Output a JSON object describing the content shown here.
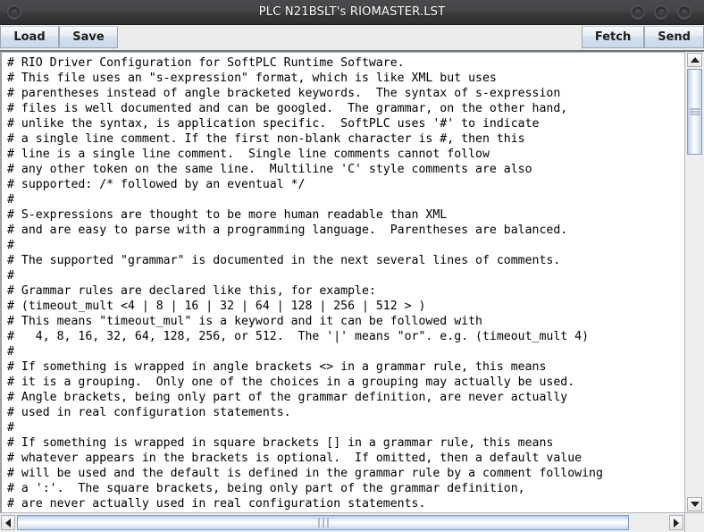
{
  "window": {
    "title": "PLC N21BSLT's RIOMASTER.LST",
    "controls": {
      "menu": "menu-button",
      "minimize": "minimize-button",
      "maximize": "maximize-button",
      "close": "close-button"
    }
  },
  "toolbar": {
    "left_buttons": [
      {
        "label": "Load",
        "name": "load-button"
      },
      {
        "label": "Save",
        "name": "save-button"
      }
    ],
    "right_buttons": [
      {
        "label": "Fetch",
        "name": "fetch-button"
      },
      {
        "label": "Send",
        "name": "send-button"
      }
    ]
  },
  "editor": {
    "lines": [
      "# RIO Driver Configuration for SoftPLC Runtime Software.",
      "# This file uses an \"s-expression\" format, which is like XML but uses",
      "# parentheses instead of angle bracketed keywords.  The syntax of s-expression",
      "# files is well documented and can be googled.  The grammar, on the other hand,",
      "# unlike the syntax, is application specific.  SoftPLC uses '#' to indicate",
      "# a single line comment. If the first non-blank character is #, then this",
      "# line is a single line comment.  Single line comments cannot follow",
      "# any other token on the same line.  Multiline 'C' style comments are also",
      "# supported: /* followed by an eventual */",
      "#",
      "# S-expressions are thought to be more human readable than XML",
      "# and are easy to parse with a programming language.  Parentheses are balanced.",
      "#",
      "# The supported \"grammar\" is documented in the next several lines of comments.",
      "#",
      "# Grammar rules are declared like this, for example:",
      "# (timeout_mult <4 | 8 | 16 | 32 | 64 | 128 | 256 | 512 > )",
      "# This means \"timeout_mul\" is a keyword and it can be followed with",
      "#   4, 8, 16, 32, 64, 128, 256, or 512.  The '|' means \"or\". e.g. (timeout_mult 4)",
      "#",
      "# If something is wrapped in angle brackets <> in a grammar rule, this means",
      "# it is a grouping.  Only one of the choices in a grouping may actually be used.",
      "# Angle brackets, being only part of the grammar definition, are never actually",
      "# used in real configuration statements.",
      "#",
      "# If something is wrapped in square brackets [] in a grammar rule, this means",
      "# whatever appears in the brackets is optional.  If omitted, then a default value",
      "# will be used and the default is defined in the grammar rule by a comment following",
      "# a ':'.  The square brackets, being only part of the grammar definition,",
      "# are never actually used in real configuration statements."
    ]
  },
  "scrollbars": {
    "vertical": {
      "up_arrow": "scroll-up-arrow",
      "down_arrow": "scroll-down-arrow",
      "thumb": "vertical-scroll-thumb"
    },
    "horizontal": {
      "left_arrow": "scroll-left-arrow",
      "right_arrow": "scroll-right-arrow",
      "thumb": "horizontal-scroll-thumb"
    }
  },
  "colors": {
    "titlebar": "#3a3a3d",
    "button_face": "#e8eef6",
    "scroll_thumb": "#c3d4ea",
    "editor_bg": "#ffffff",
    "editor_text": "#000000"
  }
}
